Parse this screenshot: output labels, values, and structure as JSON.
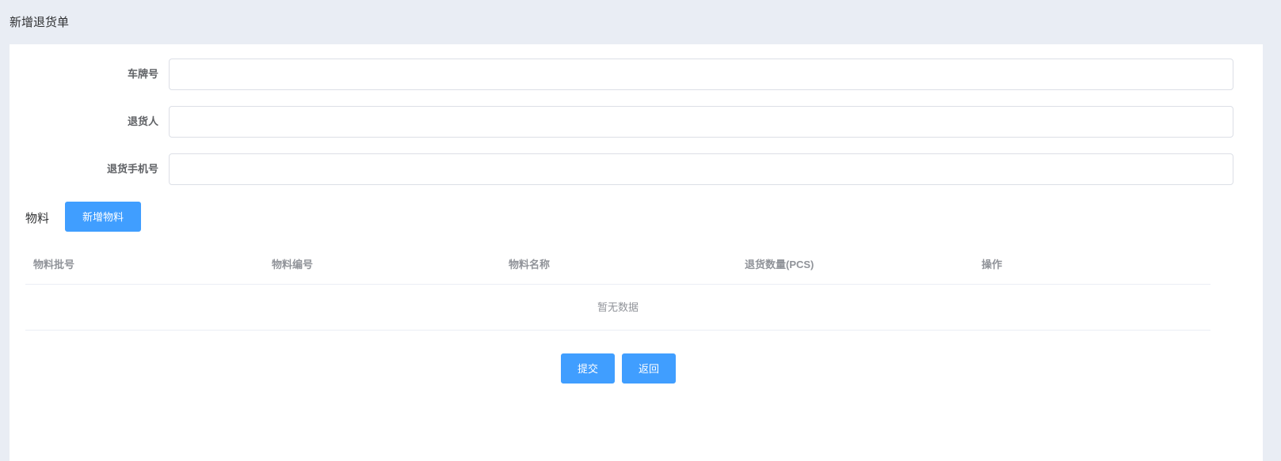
{
  "page": {
    "title": "新增退货单"
  },
  "form": {
    "plate_label": "车牌号",
    "plate_value": "",
    "returner_label": "退货人",
    "returner_value": "",
    "phone_label": "退货手机号",
    "phone_value": ""
  },
  "materials": {
    "section_label": "物料",
    "add_button": "新增物料",
    "columns": [
      "物料批号",
      "物料编号",
      "物料名称",
      "退货数量(PCS)",
      "操作"
    ],
    "rows": [],
    "empty_text": "暂无数据"
  },
  "actions": {
    "submit_label": "提交",
    "back_label": "返回"
  },
  "colors": {
    "primary": "#409eff",
    "background": "#e9edf4",
    "panel": "#ffffff"
  }
}
